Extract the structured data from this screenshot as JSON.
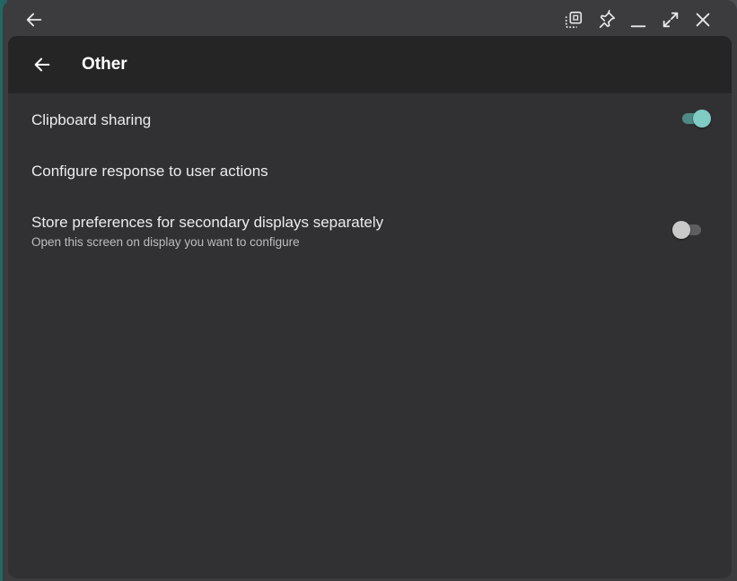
{
  "window": {
    "caption_buttons": [
      {
        "name": "back-arrow-icon"
      },
      {
        "name": "select-region-icon"
      },
      {
        "name": "pin-icon"
      },
      {
        "name": "minimize-icon"
      },
      {
        "name": "maximize-icon"
      },
      {
        "name": "close-icon"
      }
    ]
  },
  "appbar": {
    "title": "Other",
    "back_icon": "back-arrow-icon"
  },
  "settings": [
    {
      "label": "Clipboard sharing",
      "toggle": true
    },
    {
      "label": "Configure response to user actions"
    },
    {
      "label": "Store preferences for secondary displays separately",
      "summary": "Open this screen on display you want to configure",
      "toggle": false
    }
  ],
  "colors": {
    "accent": "#80cbc4",
    "appbar": "#252526",
    "background": "#313133"
  }
}
